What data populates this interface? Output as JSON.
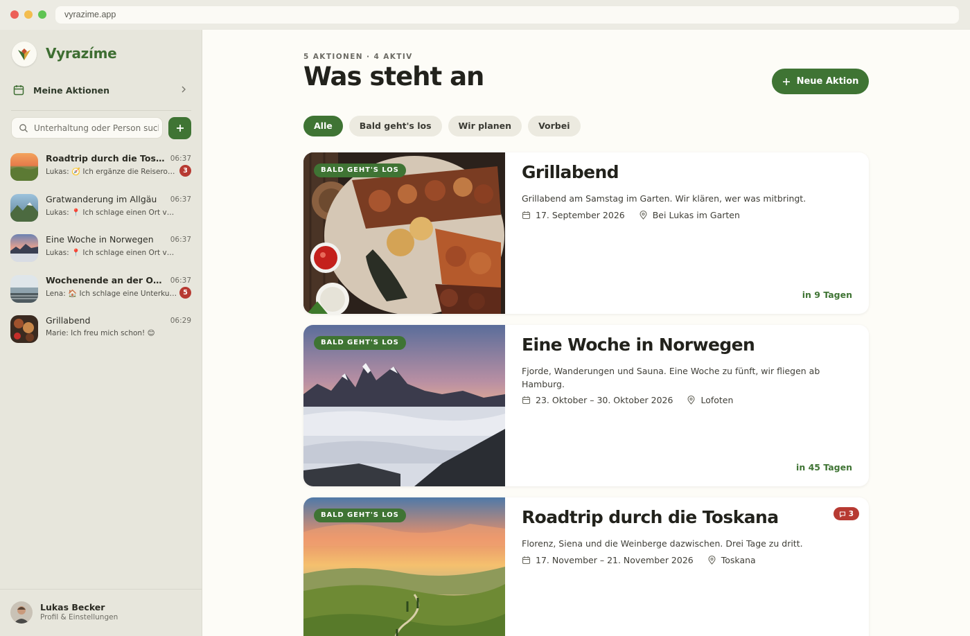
{
  "browser": {
    "url": "vyrazime.app"
  },
  "colors": {
    "brand_green": "#3f7434",
    "badge_red": "#b73a32",
    "sidebar_bg": "#e7e6dc",
    "main_bg": "#fdfcf7"
  },
  "sidebar": {
    "brand": "Vyrazíme",
    "nav": {
      "label": "Meine Aktionen",
      "icon": "calendar-icon"
    },
    "search": {
      "placeholder": "Unterhaltung oder Person suchen"
    },
    "chats": [
      {
        "title": "Roadtrip durch die Toskana",
        "time": "06:37",
        "preview": "Lukas: 🧭 Ich ergänze die Reiseroute",
        "badge": "3",
        "unread": true
      },
      {
        "title": "Gratwanderung im Allgäu",
        "time": "06:37",
        "preview": "Lukas: 📍 Ich schlage einen Ort vor: Allgäu",
        "badge": "",
        "unread": false
      },
      {
        "title": "Eine Woche in Norwegen",
        "time": "06:37",
        "preview": "Lukas: 📍 Ich schlage einen Ort vor: Lofoten",
        "badge": "",
        "unread": false
      },
      {
        "title": "Wochenende an der Ostsee",
        "time": "06:37",
        "preview": "Lena: 🏠 Ich schlage eine Unterkunft vor",
        "badge": "5",
        "unread": true
      },
      {
        "title": "Grillabend",
        "time": "06:29",
        "preview": "Marie: Ich freu mich schon! 😊",
        "badge": "",
        "unread": false
      }
    ],
    "profile": {
      "name": "Lukas Becker",
      "sub": "Profil & Einstellungen"
    }
  },
  "main": {
    "eyebrow": "5 AKTIONEN · 4 AKTIV",
    "title": "Was steht an",
    "new_button": "Neue Aktion",
    "filters": [
      "Alle",
      "Bald geht's los",
      "Wir planen",
      "Vorbei"
    ],
    "active_filter": "Alle",
    "cards": [
      {
        "status": "BALD GEHT'S LOS",
        "title": "Grillabend",
        "description": "Grillabend am Samstag im Garten. Wir klären, wer was mitbringt.",
        "date": "17. September 2026",
        "location": "Bei Lukas im Garten",
        "countdown": "in 9 Tagen",
        "badge": ""
      },
      {
        "status": "BALD GEHT'S LOS",
        "title": "Eine Woche in Norwegen",
        "description": "Fjorde, Wanderungen und Sauna. Eine Woche zu fünft, wir fliegen ab Hamburg.",
        "date": "23. Oktober – 30. Oktober 2026",
        "location": "Lofoten",
        "countdown": "in 45 Tagen",
        "badge": ""
      },
      {
        "status": "BALD GEHT'S LOS",
        "title": "Roadtrip durch die Toskana",
        "description": "Florenz, Siena und die Weinberge dazwischen. Drei Tage zu dritt.",
        "date": "17. November – 21. November 2026",
        "location": "Toskana",
        "countdown": "",
        "badge": "3"
      }
    ]
  }
}
